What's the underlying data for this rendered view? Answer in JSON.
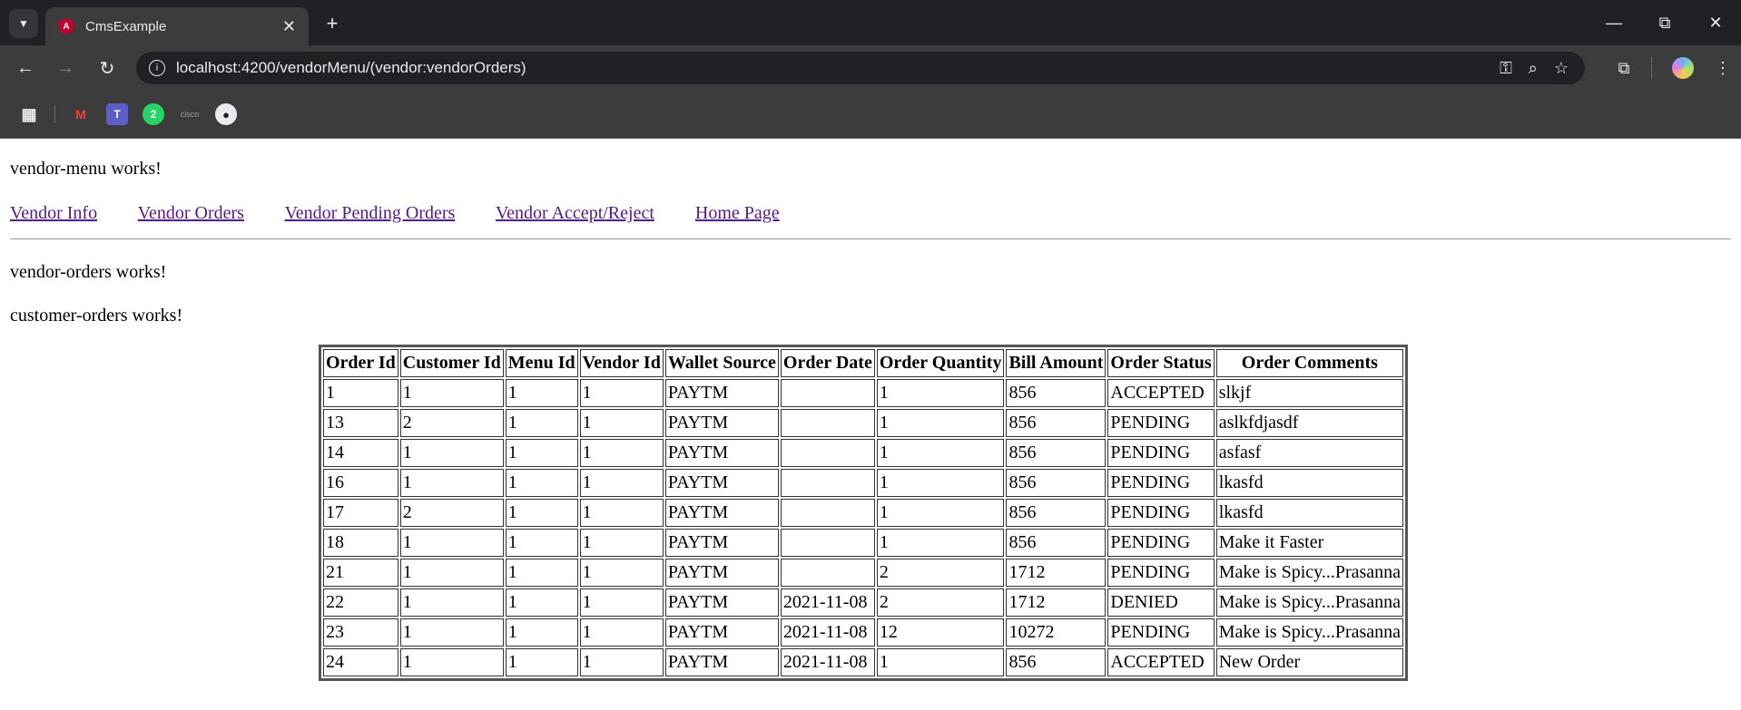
{
  "browser": {
    "tab_title": "CmsExample",
    "url": "localhost:4200/vendorMenu/(vendor:vendorOrders)",
    "bookmark_whatsapp_count": "2",
    "bookmark_teams_letter": "T",
    "bookmark_cisco_label": "cisco"
  },
  "page": {
    "vendor_menu_works": "vendor-menu works!",
    "nav_links": [
      "Vendor Info",
      "Vendor Orders",
      "Vendor Pending Orders",
      "Vendor Accept/Reject",
      "Home Page"
    ],
    "vendor_orders_works": "vendor-orders works!",
    "customer_orders_works": "customer-orders works!"
  },
  "table": {
    "headers": [
      "Order Id",
      "Customer Id",
      "Menu Id",
      "Vendor Id",
      "Wallet Source",
      "Order Date",
      "Order Quantity",
      "Bill Amount",
      "Order Status",
      "Order Comments"
    ],
    "rows": [
      [
        "1",
        "1",
        "1",
        "1",
        "PAYTM",
        "",
        "1",
        "856",
        "ACCEPTED",
        "slkjf"
      ],
      [
        "13",
        "2",
        "1",
        "1",
        "PAYTM",
        "",
        "1",
        "856",
        "PENDING",
        "aslkfdjasdf"
      ],
      [
        "14",
        "1",
        "1",
        "1",
        "PAYTM",
        "",
        "1",
        "856",
        "PENDING",
        "asfasf"
      ],
      [
        "16",
        "1",
        "1",
        "1",
        "PAYTM",
        "",
        "1",
        "856",
        "PENDING",
        "lkasfd"
      ],
      [
        "17",
        "2",
        "1",
        "1",
        "PAYTM",
        "",
        "1",
        "856",
        "PENDING",
        "lkasfd"
      ],
      [
        "18",
        "1",
        "1",
        "1",
        "PAYTM",
        "",
        "1",
        "856",
        "PENDING",
        "Make it Faster"
      ],
      [
        "21",
        "1",
        "1",
        "1",
        "PAYTM",
        "",
        "2",
        "1712",
        "PENDING",
        "Make is Spicy...Prasanna"
      ],
      [
        "22",
        "1",
        "1",
        "1",
        "PAYTM",
        "2021-11-08",
        "2",
        "1712",
        "DENIED",
        "Make is Spicy...Prasanna"
      ],
      [
        "23",
        "1",
        "1",
        "1",
        "PAYTM",
        "2021-11-08",
        "12",
        "10272",
        "PENDING",
        "Make is Spicy...Prasanna"
      ],
      [
        "24",
        "1",
        "1",
        "1",
        "PAYTM",
        "2021-11-08",
        "1",
        "856",
        "ACCEPTED",
        "New Order"
      ]
    ]
  }
}
